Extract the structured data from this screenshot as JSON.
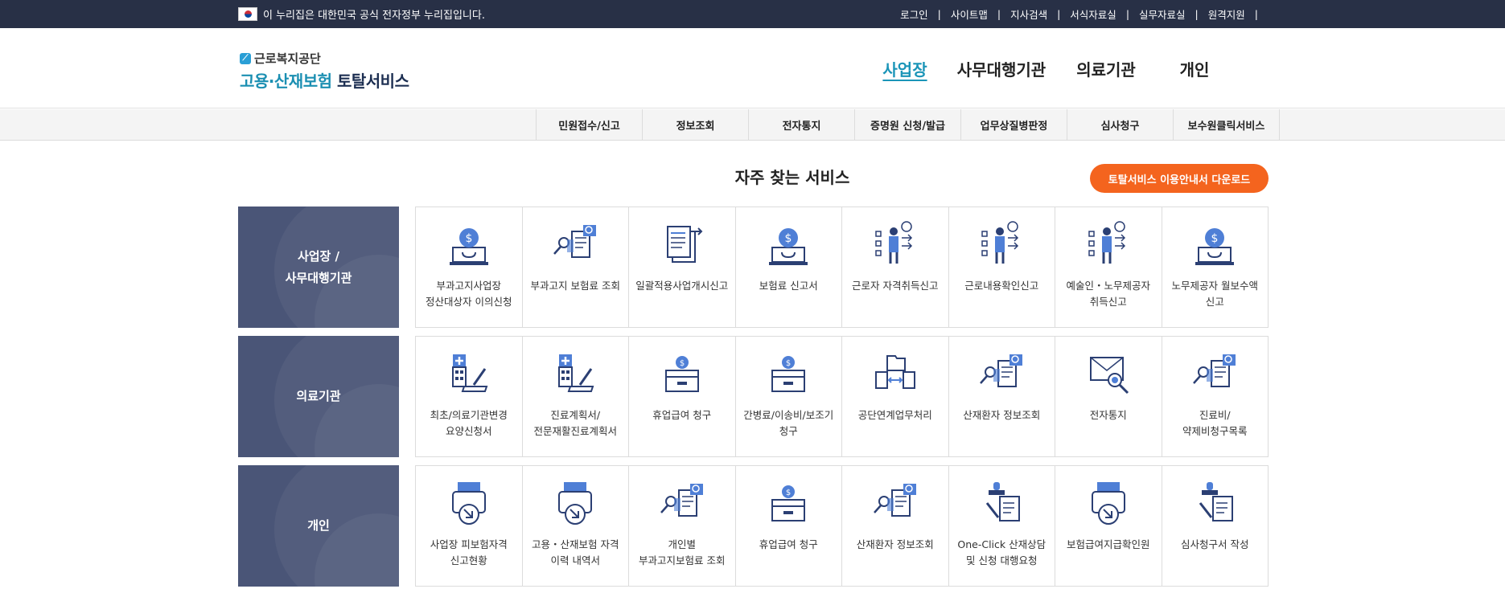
{
  "gov_banner": {
    "text": "이 누리집은 대한민국 공식 전자정부 누리집입니다.",
    "flag_icon": "korea-flag-icon"
  },
  "util_links": [
    "로그인",
    "사이트맵",
    "지사검색",
    "서식자료실",
    "실무자료실",
    "원격지원"
  ],
  "logo": {
    "org": "근로복지공단",
    "title_part1": "고용·산재보험",
    "title_part2": "토탈서비스"
  },
  "main_nav": [
    {
      "label": "사업장",
      "active": true
    },
    {
      "label": "사무대행기관",
      "active": false
    },
    {
      "label": "의료기관",
      "active": false
    },
    {
      "label": "개인",
      "active": false
    }
  ],
  "sub_nav": [
    "민원접수/신고",
    "정보조회",
    "전자통지",
    "증명원 신청/발급",
    "업무상질병판정",
    "심사청구",
    "보수원클릭서비스"
  ],
  "section": {
    "title": "자주 찾는 서비스",
    "download_button": "토탈서비스 이용안내서 다운로드"
  },
  "colors": {
    "accent_teal": "#1b95b8",
    "orange": "#f4641e",
    "category_bg": "#4a5577",
    "top_bar": "#283046",
    "icon_navy": "#2b3f73",
    "icon_blue": "#4f7fd6"
  },
  "rows": [
    {
      "category": "사업장 /\n사무대행기관",
      "services": [
        {
          "label": "부과고지사업장 정산대상자 이의신청",
          "icon": "laptop-coin-icon"
        },
        {
          "label": "부과고지 보험료 조회",
          "icon": "document-search-icon"
        },
        {
          "label": "일괄적용사업개시신고",
          "icon": "document-stack-icon"
        },
        {
          "label": "보험료 신고서",
          "icon": "laptop-coin-icon"
        },
        {
          "label": "근로자 자격취득신고",
          "icon": "person-checklist-icon"
        },
        {
          "label": "근로내용확인신고",
          "icon": "person-checklist-icon"
        },
        {
          "label": "예술인・노무제공자 취득신고",
          "icon": "person-checklist-icon"
        },
        {
          "label": "노무제공자 월보수액 신고",
          "icon": "laptop-coin-icon"
        }
      ]
    },
    {
      "category": "의료기관",
      "services": [
        {
          "label": "최초/의료기관변경 요양신청서",
          "icon": "hospital-document-icon"
        },
        {
          "label": "진료계획서/전문재활진료계획서",
          "icon": "hospital-document-icon"
        },
        {
          "label": "휴업급여 청구",
          "icon": "coin-box-icon"
        },
        {
          "label": "간병료/이송비/보조기 청구",
          "icon": "coin-box-icon"
        },
        {
          "label": "공단연계업무처리",
          "icon": "folder-exchange-icon"
        },
        {
          "label": "산재환자 정보조회",
          "icon": "document-search-icon"
        },
        {
          "label": "전자통지",
          "icon": "envelope-search-icon"
        },
        {
          "label": "진료비/약제비청구목록",
          "icon": "document-search-icon"
        }
      ]
    },
    {
      "category": "개인",
      "services": [
        {
          "label": "사업장 피보험자격 신고현황",
          "icon": "printer-download-icon"
        },
        {
          "label": "고용・산재보험 자격 이력 내역서",
          "icon": "printer-download-icon"
        },
        {
          "label": "개인별 부과고지보험료 조회",
          "icon": "document-search-icon"
        },
        {
          "label": "휴업급여 청구",
          "icon": "coin-box-icon"
        },
        {
          "label": "산재환자 정보조회",
          "icon": "document-search-icon"
        },
        {
          "label": "One-Click 산재상담 및 신청 대행요청",
          "icon": "stamp-document-icon"
        },
        {
          "label": "보험급여지급확인원",
          "icon": "printer-download-icon"
        },
        {
          "label": "심사청구서 작성",
          "icon": "stamp-document-icon"
        }
      ]
    }
  ]
}
